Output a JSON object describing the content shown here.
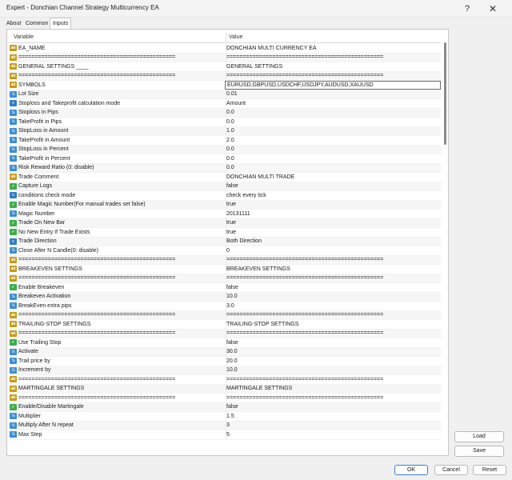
{
  "window": {
    "title": "Expert - Donchian Channel Strategy Multicurrency EA",
    "help": "?",
    "close": "✕"
  },
  "tabs": [
    "About",
    "Common",
    "Inputs"
  ],
  "table": {
    "headers": {
      "variable": "Variable",
      "value": "Value"
    },
    "rows": [
      {
        "icon": "ab",
        "name": "EA_NAME",
        "value": "DONCHIAN MULTI CURRENCY EA"
      },
      {
        "icon": "ab",
        "name": "================================================",
        "value": "================================================"
      },
      {
        "icon": "ab",
        "name": "GENERAL SETTINGS ____",
        "value": "GENERAL SETTINGS"
      },
      {
        "icon": "ab",
        "name": "================================================",
        "value": "================================================"
      },
      {
        "icon": "ab",
        "name": "SYMBOLS",
        "value": "EURUSD,GBPUSD,USDCHF,USDJPY,AUDUSD,XAUUSD",
        "selected": true
      },
      {
        "icon": "num",
        "name": "Lot Size",
        "value": "0.01"
      },
      {
        "icon": "en",
        "name": "Stoploss and Takeprofit calculation mode",
        "value": "Amount"
      },
      {
        "icon": "num",
        "name": "Stoploss in Pips",
        "value": "0.0"
      },
      {
        "icon": "num",
        "name": "TakeProfit in Pips",
        "value": "0.0"
      },
      {
        "icon": "num",
        "name": "StopLoss in Amount",
        "value": "1.0"
      },
      {
        "icon": "num",
        "name": "TakeProfit in Amount",
        "value": "2.0"
      },
      {
        "icon": "num",
        "name": "StopLoss in Percent",
        "value": "0.0"
      },
      {
        "icon": "num",
        "name": "TakeProfit in Percent",
        "value": "0.0"
      },
      {
        "icon": "num",
        "name": "Risk Reward Ratio (0: disable)",
        "value": "0.0"
      },
      {
        "icon": "ab",
        "name": "Trade Comment",
        "value": "DONCHIAN MULTI TRADE"
      },
      {
        "icon": "bl",
        "name": "Capture Logs",
        "value": "false"
      },
      {
        "icon": "en",
        "name": "conditions check mode",
        "value": "check every tick"
      },
      {
        "icon": "bl",
        "name": "Enable Magic Number(For manual trades set false)",
        "value": "true"
      },
      {
        "icon": "num",
        "name": "Magic Number",
        "value": "20131111"
      },
      {
        "icon": "bl",
        "name": "Trade On New Bar",
        "value": "true"
      },
      {
        "icon": "bl",
        "name": "No New Entry If Trade Exists",
        "value": "true"
      },
      {
        "icon": "en",
        "name": "Trade Direction",
        "value": "Both Direction"
      },
      {
        "icon": "num",
        "name": "Close After N Candle(0: disable)",
        "value": "0"
      },
      {
        "icon": "ab",
        "name": "================================================",
        "value": "================================================"
      },
      {
        "icon": "ab",
        "name": "BREAKEVEN SETTINGS",
        "value": "BREAKEVEN SETTINGS"
      },
      {
        "icon": "ab",
        "name": "================================================",
        "value": "================================================"
      },
      {
        "icon": "bl",
        "name": "Enable Breakeven",
        "value": "false"
      },
      {
        "icon": "num",
        "name": "Breakeven Activation",
        "value": "10.0"
      },
      {
        "icon": "num",
        "name": "BreakEven extra pips",
        "value": "3.0"
      },
      {
        "icon": "ab",
        "name": "================================================",
        "value": "================================================"
      },
      {
        "icon": "ab",
        "name": "TRAILING-STOP SETTINGS",
        "value": "TRAILING-STOP SETTINGS"
      },
      {
        "icon": "ab",
        "name": "================================================",
        "value": "================================================"
      },
      {
        "icon": "bl",
        "name": "Use Trailing Stop",
        "value": "false"
      },
      {
        "icon": "num",
        "name": "Activate",
        "value": "30.0"
      },
      {
        "icon": "num",
        "name": "Trail price by",
        "value": "20.0"
      },
      {
        "icon": "num",
        "name": "Increment by",
        "value": "10.0"
      },
      {
        "icon": "ab",
        "name": "================================================",
        "value": "================================================"
      },
      {
        "icon": "ab",
        "name": "MARTINGALE SETTINGS",
        "value": "MARTINGALE SETTINGS"
      },
      {
        "icon": "ab",
        "name": "================================================",
        "value": "================================================"
      },
      {
        "icon": "bl",
        "name": "Enable/Disable Martingale",
        "value": "false"
      },
      {
        "icon": "num",
        "name": "Multiplier",
        "value": "1.5"
      },
      {
        "icon": "num",
        "name": "Multiply After N repeat",
        "value": "3"
      },
      {
        "icon": "num",
        "name": "Max Step",
        "value": "5"
      }
    ]
  },
  "icon_glyphs": {
    "ab": "ab",
    "num": "½",
    "bl": "✓",
    "en": "≡"
  },
  "buttons": {
    "load": "Load",
    "save": "Save",
    "ok": "OK",
    "cancel": "Cancel",
    "reset": "Reset"
  }
}
